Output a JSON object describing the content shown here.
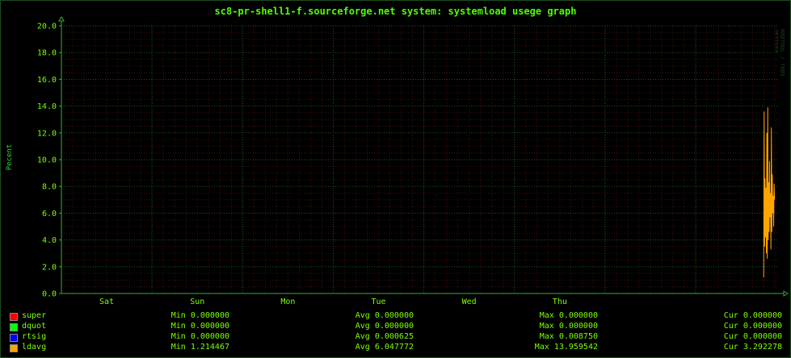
{
  "title": "sc8-pr-shell1-f.sourceforge.net system: systemload usege graph",
  "watermark": "RRDTOOL / TOBI OETIKER",
  "colors": {
    "background": "#000000",
    "grid_major": "#1f5a1f",
    "grid_minor": "#3a0f0f",
    "text": "#7fff00",
    "ldavg": "#ffa500"
  },
  "chart_data": {
    "type": "line",
    "title": "sc8-pr-shell1-f.sourceforge.net system: systemload usege graph",
    "ylabel": "Pecent",
    "xlabel": "",
    "ylim": [
      0,
      20
    ],
    "y_ticks": [
      "0.0",
      "2.0",
      "4.0",
      "6.0",
      "8.0",
      "10.0",
      "12.0",
      "14.0",
      "16.0",
      "18.0",
      "20.0"
    ],
    "x_ticks": [
      "Sat",
      "Sun",
      "Mon",
      "Tue",
      "Wed",
      "Thu"
    ],
    "grid": true,
    "legend_placement": "bottom",
    "x_range_days": [
      0,
      7.9
    ],
    "x_tick_positions_days": [
      0.5,
      1.5,
      2.5,
      3.5,
      4.5,
      5.5
    ],
    "series": [
      {
        "name": "super",
        "color": "#ff0000",
        "min": "0.000000",
        "avg": "0.000000",
        "max": "0.000000",
        "cur": "0.000000",
        "values": []
      },
      {
        "name": "dquot",
        "color": "#00ff00",
        "min": "0.000000",
        "avg": "0.000000",
        "max": "0.000000",
        "cur": "0.000000",
        "values": []
      },
      {
        "name": "rtsig",
        "color": "#0000ff",
        "min": "0.000000",
        "avg": "0.000625",
        "max": "0.008750",
        "cur": "0.000000",
        "values": []
      },
      {
        "name": "ldavg",
        "color": "#ffa500",
        "min": "1.214467",
        "avg": "6.047772",
        "max": "13.959542",
        "cur": "3.292278",
        "x": [
          7.75,
          7.755,
          7.76,
          7.765,
          7.77,
          7.775,
          7.78,
          7.785,
          7.79,
          7.795,
          7.8,
          7.805,
          7.81,
          7.815,
          7.82,
          7.825,
          7.83,
          7.835,
          7.84,
          7.845,
          7.85,
          7.855,
          7.86,
          7.865,
          7.87
        ],
        "values": [
          1.2,
          13.6,
          3.5,
          8.6,
          4.2,
          7.9,
          3.0,
          12.0,
          2.6,
          13.9,
          4.0,
          8.3,
          4.6,
          9.9,
          5.7,
          7.5,
          3.3,
          12.4,
          4.6,
          8.9,
          6.0,
          7.3,
          5.0,
          8.2,
          7.0
        ]
      }
    ]
  }
}
